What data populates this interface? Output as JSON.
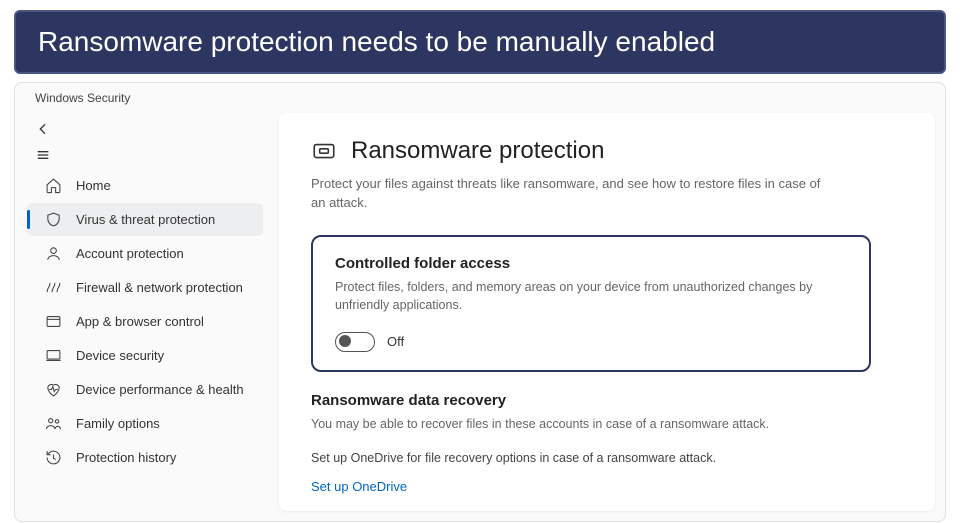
{
  "banner": "Ransomware protection needs to be manually enabled",
  "window": {
    "title": "Windows Security"
  },
  "sidebar": {
    "items": [
      {
        "label": "Home"
      },
      {
        "label": "Virus & threat protection"
      },
      {
        "label": "Account protection"
      },
      {
        "label": "Firewall & network protection"
      },
      {
        "label": "App & browser control"
      },
      {
        "label": "Device security"
      },
      {
        "label": "Device performance & health"
      },
      {
        "label": "Family options"
      },
      {
        "label": "Protection history"
      }
    ]
  },
  "content": {
    "page_title": "Ransomware protection",
    "page_desc": "Protect your files against threats like ransomware, and see how to restore files in case of an attack.",
    "cfa": {
      "title": "Controlled folder access",
      "desc": "Protect files, folders, and memory areas on your device from unauthorized changes by unfriendly applications.",
      "toggle_state": "Off"
    },
    "rdr": {
      "title": "Ransomware data recovery",
      "desc": "You may be able to recover files in these accounts in case of a ransomware attack.",
      "note": "Set up OneDrive for file recovery options in case of a ransomware attack.",
      "link": "Set up OneDrive"
    }
  }
}
